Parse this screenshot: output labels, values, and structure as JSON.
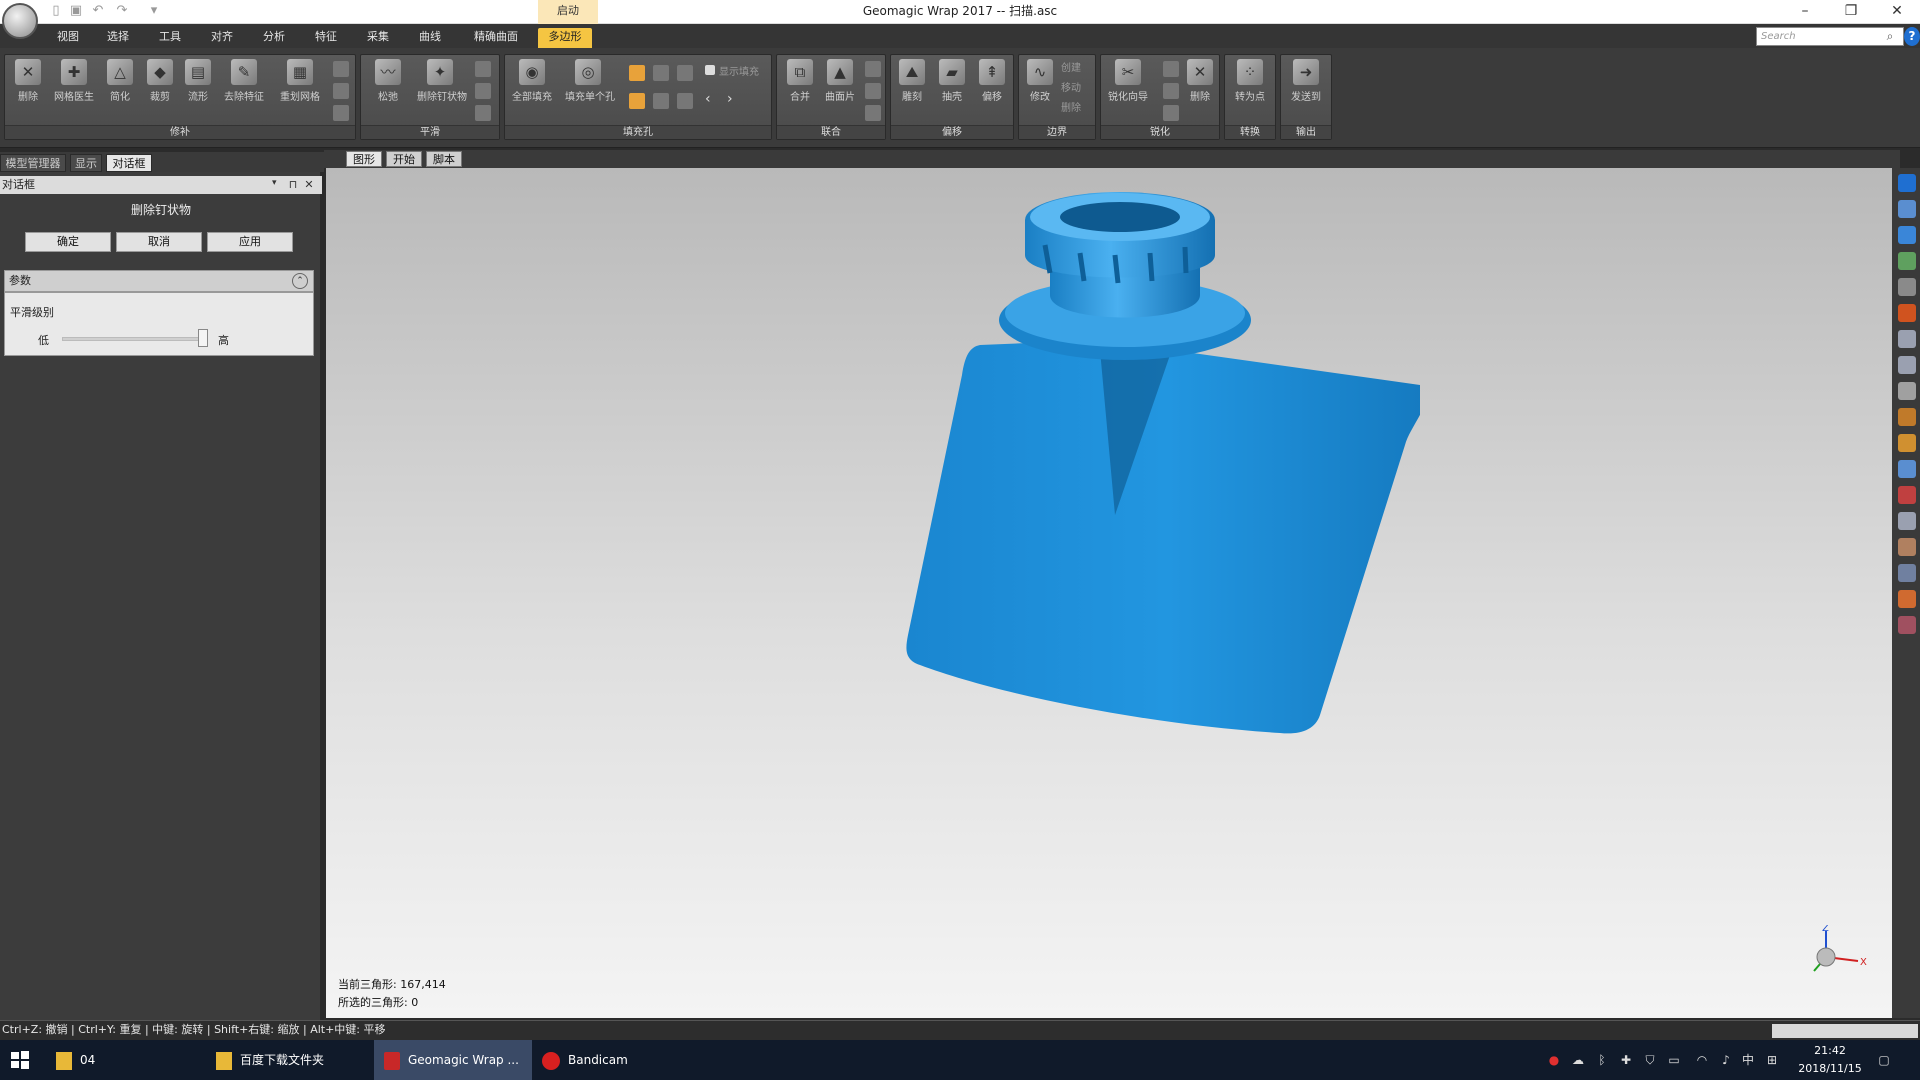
{
  "window": {
    "title": "Geomagic Wrap 2017 -- 扫描.asc",
    "context_tab": "启动",
    "minimize": "–",
    "restore": "❐",
    "close": "✕"
  },
  "menu": {
    "items": [
      "视图",
      "选择",
      "工具",
      "对齐",
      "分析",
      "特征",
      "采集",
      "曲线",
      "精确曲面",
      "多边形"
    ]
  },
  "search": {
    "placeholder": "Search"
  },
  "help": "?",
  "ribbon": {
    "groups": [
      {
        "label": "修补",
        "buttons": [
          "删除",
          "网格医生",
          "简化",
          "裁剪",
          "流形",
          "去除特征",
          "重划网格"
        ]
      },
      {
        "label": "平滑",
        "buttons": [
          "松弛",
          "删除钉状物"
        ]
      },
      {
        "label": "填充孔",
        "buttons": [
          "全部填充",
          "填充单个孔"
        ],
        "checkbox_label": "显示填充"
      },
      {
        "label": "联合",
        "buttons": [
          "合并",
          "曲面片"
        ]
      },
      {
        "label": "偏移",
        "buttons": [
          "雕刻",
          "抽壳",
          "偏移"
        ]
      },
      {
        "label": "边界",
        "buttons": [
          "修改"
        ],
        "side_items": [
          "创建",
          "移动",
          "删除"
        ]
      },
      {
        "label": "锐化",
        "buttons": [
          "锐化向导",
          "删除"
        ]
      },
      {
        "label": "转换",
        "buttons": [
          "转为点"
        ]
      },
      {
        "label": "输出",
        "buttons": [
          "发送到"
        ]
      }
    ]
  },
  "panel": {
    "tabs": [
      "模型管理器",
      "显示",
      "对话框"
    ],
    "header": "对话框",
    "pin": "⊓",
    "close": "✕",
    "dialog_title": "删除钉状物",
    "buttons": {
      "ok": "确定",
      "cancel": "取消",
      "apply": "应用"
    },
    "params": {
      "title": "参数",
      "collapse": "⌃",
      "smooth_level_label": "平滑级别",
      "low": "低",
      "high": "高",
      "smooth_level": 1.0
    }
  },
  "viewport": {
    "tabs": [
      "图形",
      "开始",
      "脚本"
    ],
    "stats": {
      "current_triangles": "当前三角形: 167,414",
      "selected_triangles": "所选的三角形: 0"
    },
    "axis": {
      "z": "Z",
      "x": "X"
    }
  },
  "status": {
    "text": "Ctrl+Z: 撤销 | Ctrl+Y: 重复 | 中键: 旋转 | Shift+右键: 缩放 | Alt+中键: 平移"
  },
  "taskbar": {
    "items": [
      "04",
      "百度下载文件夹",
      "Geomagic Wrap ...",
      "Bandicam"
    ],
    "clock": {
      "time": "21:42",
      "date": "2018/11/15"
    },
    "ime": "中"
  },
  "colors": {
    "model": "#1e8fd6",
    "active_tab": "#f5c542"
  }
}
